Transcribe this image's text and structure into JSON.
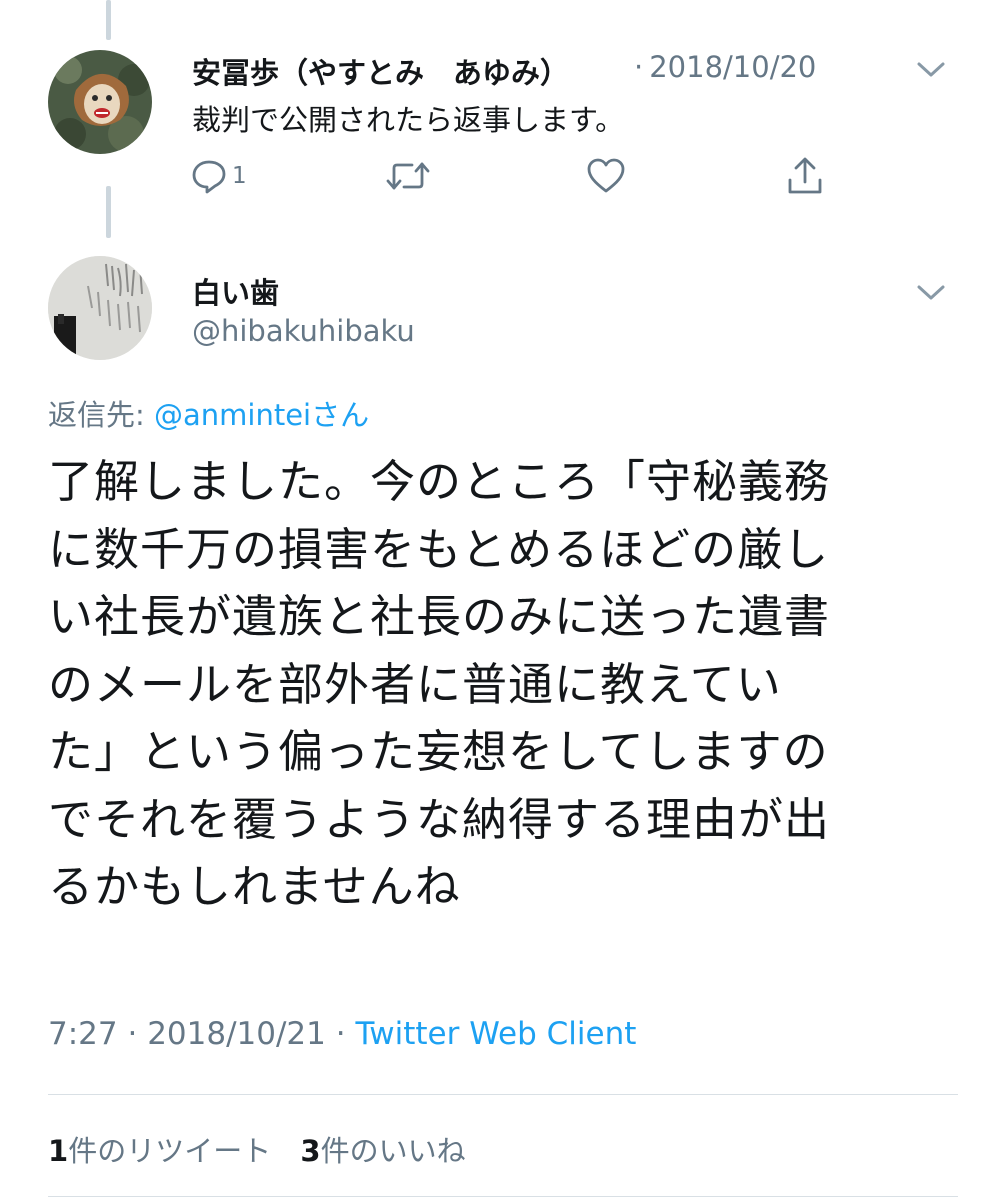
{
  "reply_tweet": {
    "display_name": "安冨歩（やすとみ　あゆみ）",
    "meta_separator": "·",
    "date": "2018/10/20",
    "text": "裁判で公開されたら返事します。",
    "reply_count": "1",
    "icons": {
      "reply": "reply-icon",
      "retweet": "retweet-icon",
      "like": "like-icon",
      "share": "share-icon",
      "menu": "chevron-down-icon"
    }
  },
  "main_tweet": {
    "display_name": "白い歯",
    "handle": "@hibakuhibaku",
    "replying_to_prefix": "返信先: ",
    "replying_to_handle": "@anmintei",
    "replying_to_suffix": "さん",
    "text_lines": [
      "了解しました。今のところ「守秘義務",
      "に数千万の損害をもとめるほどの厳し",
      "い社長が遺族と社長のみに送った遺書",
      "のメールを部外者に普通に教えてい",
      "た」という偏った妄想をしてしますの",
      "でそれを覆うような納得する理由が出",
      "るかもしれませんね"
    ],
    "time": "7:27",
    "meta_separator": "·",
    "date": "2018/10/21",
    "client": "Twitter Web Client",
    "stats": {
      "retweet_count": "1",
      "retweet_label": "件のリツイート",
      "like_count": "3",
      "like_label": "件のいいね"
    }
  },
  "colors": {
    "link": "#1da1f2",
    "muted": "#657786",
    "text": "#14171a",
    "thread_line": "#ccd6dd"
  }
}
